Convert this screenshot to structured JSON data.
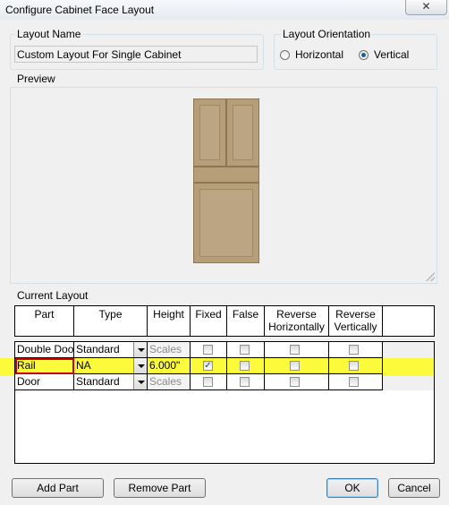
{
  "window": {
    "title": "Configure Cabinet Face Layout",
    "close_glyph": "✕"
  },
  "layout_name": {
    "label": "Layout Name",
    "value": "Custom Layout For Single Cabinet"
  },
  "orientation": {
    "label": "Layout Orientation",
    "options": [
      {
        "label": "Horizontal",
        "selected": false
      },
      {
        "label": "Vertical",
        "selected": true
      }
    ]
  },
  "preview": {
    "label": "Preview"
  },
  "current_layout": {
    "label": "Current Layout",
    "columns": [
      "Part",
      "Type",
      "Height",
      "Fixed",
      "False",
      "Reverse Horizontally",
      "Reverse Vertically"
    ],
    "rows": [
      {
        "part": "Double Door",
        "type": "Standard",
        "height": "Scales",
        "fixed": false,
        "false": false,
        "rev_h": false,
        "rev_v": false
      },
      {
        "part": "Rail",
        "type": "NA",
        "height": "6.000\"",
        "fixed": true,
        "false": false,
        "rev_h": false,
        "rev_v": false
      },
      {
        "part": "Door",
        "type": "Standard",
        "height": "Scales",
        "fixed": false,
        "false": false,
        "rev_h": false,
        "rev_v": false
      }
    ]
  },
  "buttons": {
    "add_part": "Add Part",
    "remove_part": "Remove Part",
    "ok": "OK",
    "cancel": "Cancel"
  },
  "colors": {
    "highlight": "#ffff00",
    "selected_cell_border": "#cc0000",
    "cabinet_wood": "#b59e78"
  }
}
